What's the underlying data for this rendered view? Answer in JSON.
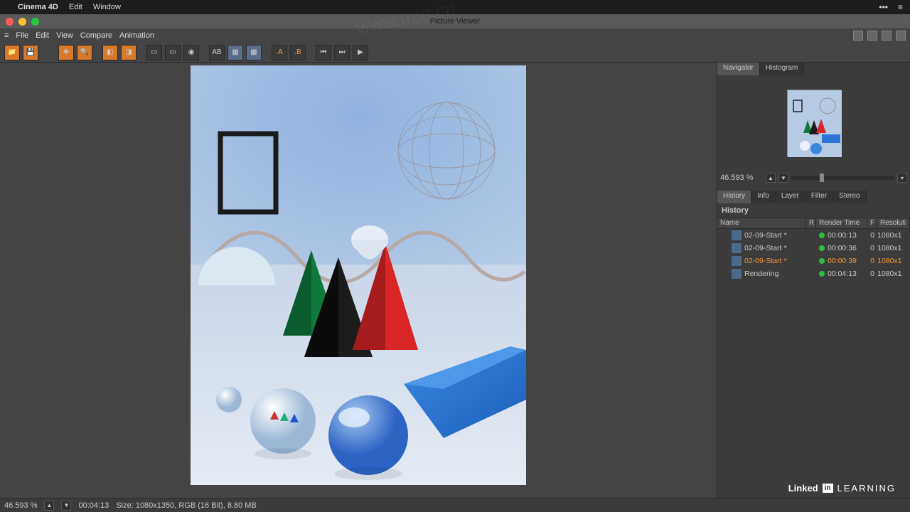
{
  "mac_menu": {
    "app": "Cinema 4D",
    "items": [
      "Edit",
      "Window"
    ]
  },
  "window": {
    "title": "Picture Viewer",
    "menu": [
      "File",
      "Edit",
      "View",
      "Compare",
      "Animation"
    ]
  },
  "toolbar_icons": [
    "open",
    "save",
    "sep",
    "move",
    "zoom",
    "sep",
    "panel1",
    "panel2",
    "aspect1",
    "aspect2",
    "overlay",
    "sep",
    "ab-compare",
    "grid1",
    "grid2",
    "sep",
    "a-label",
    "b-label",
    "sep",
    "prev",
    "next",
    "play"
  ],
  "right": {
    "nav_tabs": [
      "Navigator",
      "Histogram"
    ],
    "zoom_pct": "46.593 %",
    "history_tabs": [
      "History",
      "Info",
      "Layer",
      "Filter",
      "Stereo"
    ],
    "history_title": "History",
    "columns": {
      "name": "Name",
      "r": "R",
      "rt": "Render Time",
      "f": "F",
      "res": "Resoluti"
    },
    "rows": [
      {
        "name": "02-09-Start *",
        "time": "00:00:13",
        "f": "0",
        "res": "1080x1",
        "sel": false
      },
      {
        "name": "02-09-Start *",
        "time": "00:00:36",
        "f": "0",
        "res": "1080x1",
        "sel": false
      },
      {
        "name": "02-09-Start *",
        "time": "00:00:39",
        "f": "0",
        "res": "1080x1",
        "sel": true
      },
      {
        "name": "Rendering",
        "time": "00:04:13",
        "f": "0",
        "res": "1080x1",
        "sel": false
      }
    ]
  },
  "status": {
    "zoom": "46.593 %",
    "time": "00:04:13",
    "info": "Size: 1080x1350, RGB (16 Bit), 8.80 MB"
  },
  "brand": {
    "linked": "Linked",
    "in": "in",
    "learning": "LEARNING"
  },
  "watermark_url": "www.rrcg.cn"
}
